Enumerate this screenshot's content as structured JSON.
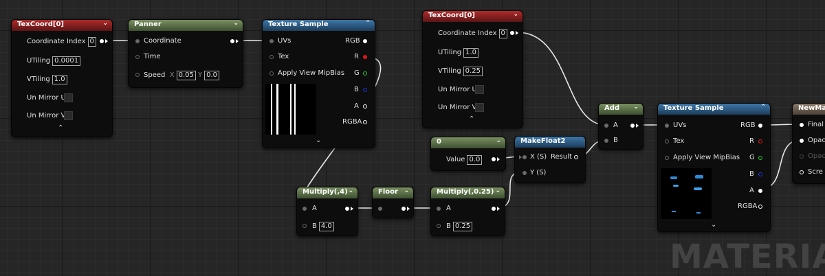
{
  "nodes": {
    "texcoord1": {
      "title": "TexCoord[0]",
      "coord_label": "Coordinate Index",
      "coord_value": "0",
      "utiling_label": "UTiling",
      "utiling_value": "0.0001",
      "vtiling_label": "VTiling",
      "vtiling_value": "1.0",
      "mirror_u": "Un Mirror U",
      "mirror_v": "Un Mirror V"
    },
    "panner": {
      "title": "Panner",
      "coordinate": "Coordinate",
      "time": "Time",
      "speed": "Speed",
      "x_label": "X",
      "x_value": "0.05",
      "y_label": "Y",
      "y_value": "0.0"
    },
    "texsample1": {
      "title": "Texture Sample",
      "uvs": "UVs",
      "tex": "Tex",
      "mip": "Apply View MipBias",
      "rgb": "RGB",
      "r": "R",
      "g": "G",
      "b": "B",
      "a": "A",
      "rgba": "RGBA"
    },
    "texcoord2": {
      "title": "TexCoord[0]",
      "coord_label": "Coordinate Index",
      "coord_value": "0",
      "utiling_label": "UTiling",
      "utiling_value": "1.0",
      "vtiling_label": "VTiling",
      "vtiling_value": "0.25",
      "mirror_u": "Un Mirror U",
      "mirror_v": "Un Mirror V"
    },
    "add": {
      "title": "Add",
      "a": "A",
      "b": "B"
    },
    "texsample2": {
      "title": "Texture Sample",
      "uvs": "UVs",
      "tex": "Tex",
      "mip": "Apply View MipBias",
      "rgb": "RGB",
      "r": "R",
      "g": "G",
      "b": "B",
      "a": "A",
      "rgba": "RGBA"
    },
    "newmat": {
      "title": "NewMate",
      "final": "Final",
      "opac": "Opac",
      "opac2": "Opac",
      "scre": "Scre"
    },
    "const0": {
      "title": "0",
      "value_label": "Value",
      "value": "0.0"
    },
    "makefloat2": {
      "title": "MakeFloat2",
      "x": "X (S)",
      "y": "Y (S)",
      "result": "Result"
    },
    "multiply4": {
      "title": "Multiply(,4)",
      "a": "A",
      "b": "B",
      "b_value": "4.0"
    },
    "floor": {
      "title": "Floor"
    },
    "multiply025": {
      "title": "Multiply(,0.25)",
      "a": "A",
      "b": "B",
      "b_value": "0.25"
    }
  },
  "watermark": "MATERIAL",
  "colors": {
    "red_header": "#b02a2a",
    "green_header": "#7a9060",
    "blue_header": "#3d77a8",
    "tan_header": "#8a7a68",
    "canvas": "#262626"
  }
}
